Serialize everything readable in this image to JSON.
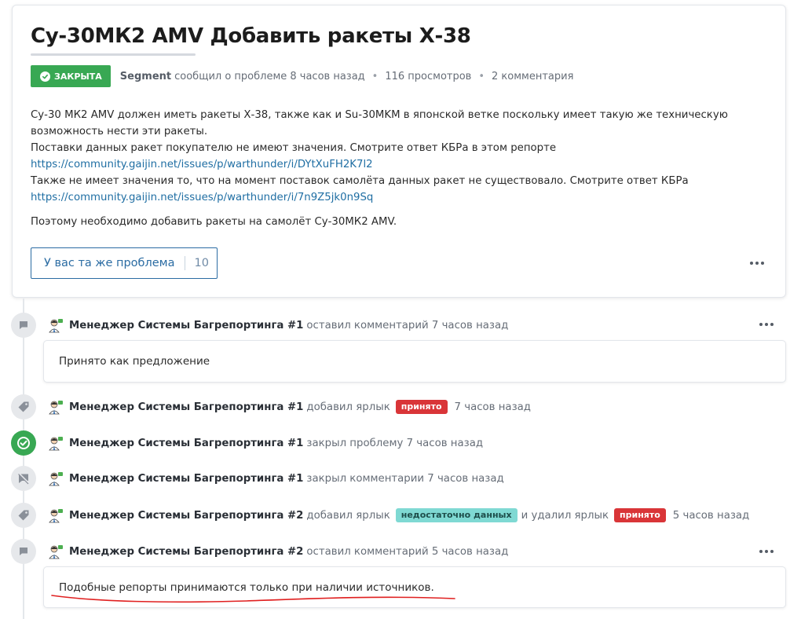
{
  "issue": {
    "title": "Су-30МК2 AMV Добавить ракеты Х-38",
    "status": "ЗАКРЫТА",
    "author": "Segment",
    "reported": "сообщил о проблеме 8 часов назад",
    "views": "116 просмотров",
    "comments": "2 комментария",
    "description": {
      "line1": "Су-30 МК2 AMV должен иметь ракеты Х-38, также как и Su-30MKM в японской ветке поскольку имеет такую же техническую возможность нести эти ракеты.",
      "line2": "Поставки данных ракет покупателю не имеют значения. Смотрите ответ КБРа в этом репорте",
      "link1": "https://community.gaijin.net/issues/p/warthunder/i/DYtXuFH2K7l2",
      "line3": "Также не имеет значения то, что на момент поставок самолёта данных ракет не существовало. Смотрите ответ КБРа",
      "link2": "https://community.gaijin.net/issues/p/warthunder/i/7n9Z5jk0n9Sq",
      "line4": "Поэтому необходимо добавить ракеты на самолёт Су-30МК2 AMV."
    },
    "same_problem_label": "У вас та же проблема",
    "same_problem_count": "10"
  },
  "timeline": [
    {
      "type": "comment",
      "icon": "comment-icon",
      "who": "Менеджер Системы Багрепортинга #1",
      "action": "оставил комментарий 7 часов назад",
      "text": "Принято как предложение"
    },
    {
      "type": "label",
      "icon": "tag-icon",
      "who": "Менеджер Системы Багрепортинга #1",
      "action": "добавил ярлык",
      "tag": "принято",
      "time": "7 часов назад"
    },
    {
      "type": "closed",
      "icon": "check-circle-icon",
      "who": "Менеджер Системы Багрепортинга #1",
      "action": "закрыл проблему 7 часов назад"
    },
    {
      "type": "locked",
      "icon": "comment-off-icon",
      "who": "Менеджер Системы Багрепортинга #1",
      "action": "закрыл комментарии 7 часов назад"
    },
    {
      "type": "label",
      "icon": "tag-icon",
      "who": "Менеджер Системы Багрепортинга #2",
      "action": "добавил ярлык",
      "tag": "недостаточно данных",
      "action2": "и удалил ярлык",
      "tag2": "принято",
      "time": "5 часов назад"
    },
    {
      "type": "comment",
      "icon": "comment-icon",
      "who": "Менеджер Системы Багрепортинга #2",
      "action": "оставил комментарий 5 часов назад",
      "text": "Подобные репорты принимаются только при наличии источников."
    }
  ],
  "colors": {
    "closed_green": "#38a853",
    "link_blue": "#1f6ea3",
    "tag_red": "#d93538",
    "tag_teal": "#7fd9d3",
    "annotation_red": "#e02020"
  }
}
